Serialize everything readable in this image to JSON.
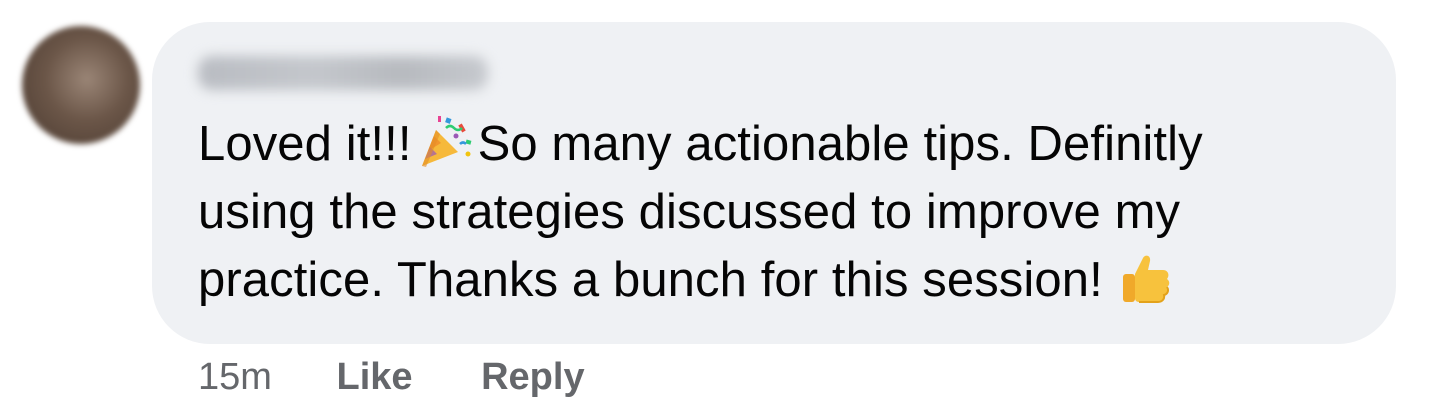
{
  "comment": {
    "author": "",
    "avatar_icon": "profile-avatar",
    "text_lines": {
      "line1_a": "Loved it!!!",
      "line1_b": "So many actionable tips. Definitly",
      "line2": "using the strategies discussed to improve my",
      "line3": "practice. Thanks a bunch for this session!"
    },
    "emojis": {
      "party": "party-popper-icon",
      "thumbs": "thumbs-up-icon"
    },
    "timestamp": "15m",
    "like_label": "Like",
    "reply_label": "Reply",
    "colors": {
      "bubble": "#eff1f4",
      "text": "#050505",
      "meta": "#65676b"
    }
  }
}
